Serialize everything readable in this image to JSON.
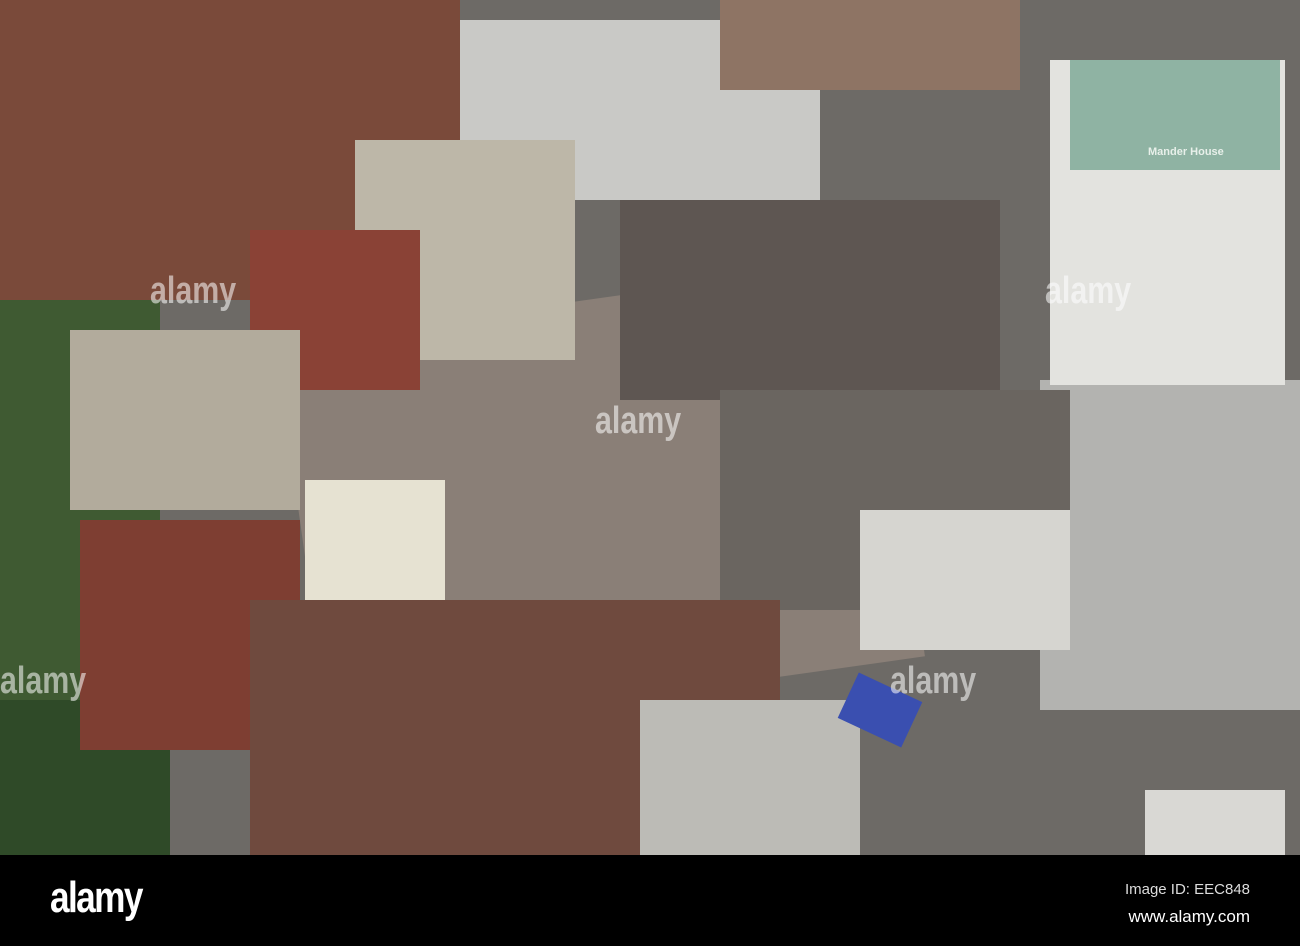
{
  "photo": {
    "building_sign": "Mander House"
  },
  "watermark": {
    "text": "alamy"
  },
  "footer": {
    "logo": "alamy",
    "image_id": "Image ID: EEC848",
    "url": "www.alamy.com"
  }
}
